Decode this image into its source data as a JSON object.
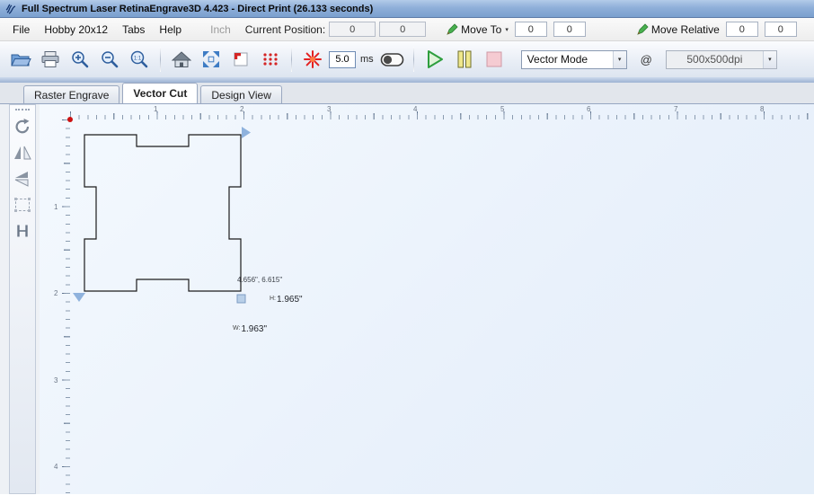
{
  "window": {
    "title": "Full Spectrum Laser RetinaEngrave3D 4.423 - Direct Print (26.133 seconds)"
  },
  "menubar": {
    "items": {
      "file": "File",
      "hobby": "Hobby 20x12",
      "tabs": "Tabs",
      "help": "Help"
    },
    "unit": "Inch",
    "current_position": {
      "label": "Current Position:",
      "x": "0",
      "y": "0"
    },
    "move_to": {
      "label": "Move To",
      "x": "0",
      "y": "0"
    },
    "move_relative": {
      "label": "Move Relative",
      "x": "0",
      "y": "0"
    }
  },
  "toolbar": {
    "zoom_actual": "1:1",
    "pulse_value": "5.0",
    "pulse_unit": "ms",
    "mode": {
      "value": "Vector Mode"
    },
    "at": "@",
    "dpi": {
      "value": "500x500dpi"
    }
  },
  "tabs": {
    "raster": "Raster Engrave",
    "vector": "Vector Cut",
    "design": "Design View"
  },
  "rulers": {
    "horizontal": [
      "1",
      "2",
      "3",
      "4",
      "5",
      "6",
      "7",
      "8"
    ],
    "vertical": [
      "1",
      "2",
      "3",
      "4"
    ]
  },
  "selection": {
    "position_readout": "4.656\", 6.615\"",
    "h_label": "H:",
    "h_value": "1.965\"",
    "w_label": "W:",
    "w_value": "1.963\""
  },
  "icons": {
    "chevron_down": "▾"
  },
  "colors": {
    "titlebar_blue": "#8fafd9",
    "laser_red": "#e32222",
    "play_green": "#2e9e3e",
    "selection_handle_blue": "#8fb2dd",
    "origin_red": "#cc1111"
  }
}
